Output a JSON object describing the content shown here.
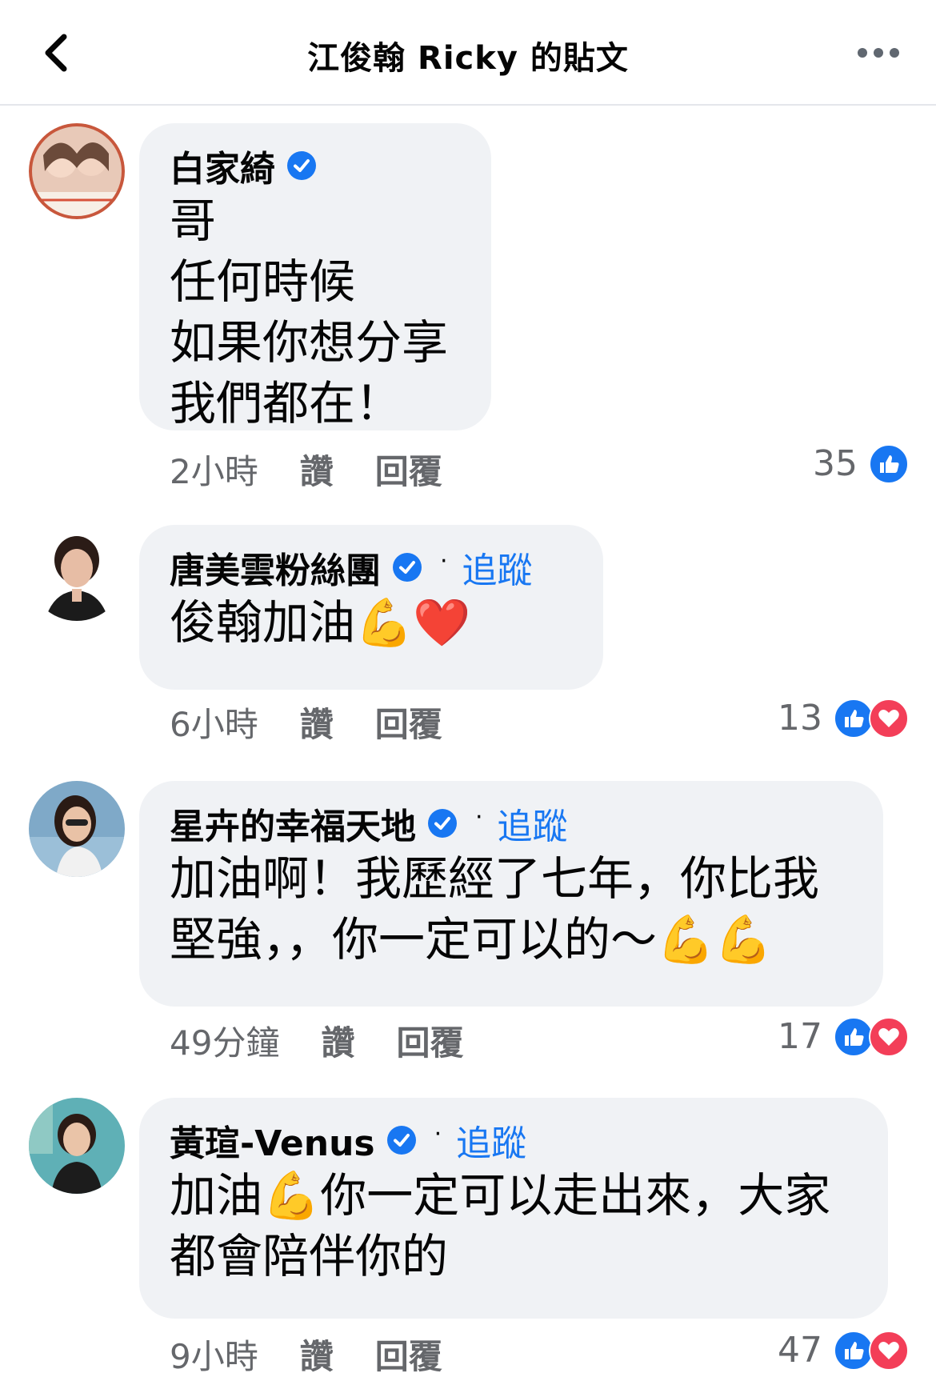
{
  "header": {
    "title": "江俊翰 Ricky 的貼文"
  },
  "colors": {
    "accent": "#1877f2",
    "love": "#f33e58",
    "bubble": "#f0f2f5",
    "meta": "#65676b"
  },
  "comments": [
    {
      "author": "白家綺",
      "verified": true,
      "follow_label": "",
      "text": "哥\n任何時候\n如果你想分享\n我們都在！",
      "time": "2小時",
      "like_label": "讚",
      "reply_label": "回覆",
      "reaction_count": "35",
      "reactions": [
        "like-icon"
      ]
    },
    {
      "author": "唐美雲粉絲團",
      "verified": true,
      "follow_label": "追蹤",
      "text": "俊翰加油💪❤️",
      "time": "6小時",
      "like_label": "讚",
      "reply_label": "回覆",
      "reaction_count": "13",
      "reactions": [
        "like-icon",
        "love-icon"
      ]
    },
    {
      "author": "星卉的幸福天地",
      "verified": true,
      "follow_label": "追蹤",
      "text": "加油啊！我歷經了七年，你比我\n堅強，，你一定可以的～💪💪",
      "time": "49分鐘",
      "like_label": "讚",
      "reply_label": "回覆",
      "reaction_count": "17",
      "reactions": [
        "like-icon",
        "love-icon"
      ]
    },
    {
      "author": "黃瑄-Venus",
      "verified": true,
      "follow_label": "追蹤",
      "text": "加油💪你一定可以走出來，大家\n都會陪伴你的",
      "time": "9小時",
      "like_label": "讚",
      "reply_label": "回覆",
      "reaction_count": "47",
      "reactions": [
        "like-icon",
        "love-icon"
      ]
    }
  ]
}
